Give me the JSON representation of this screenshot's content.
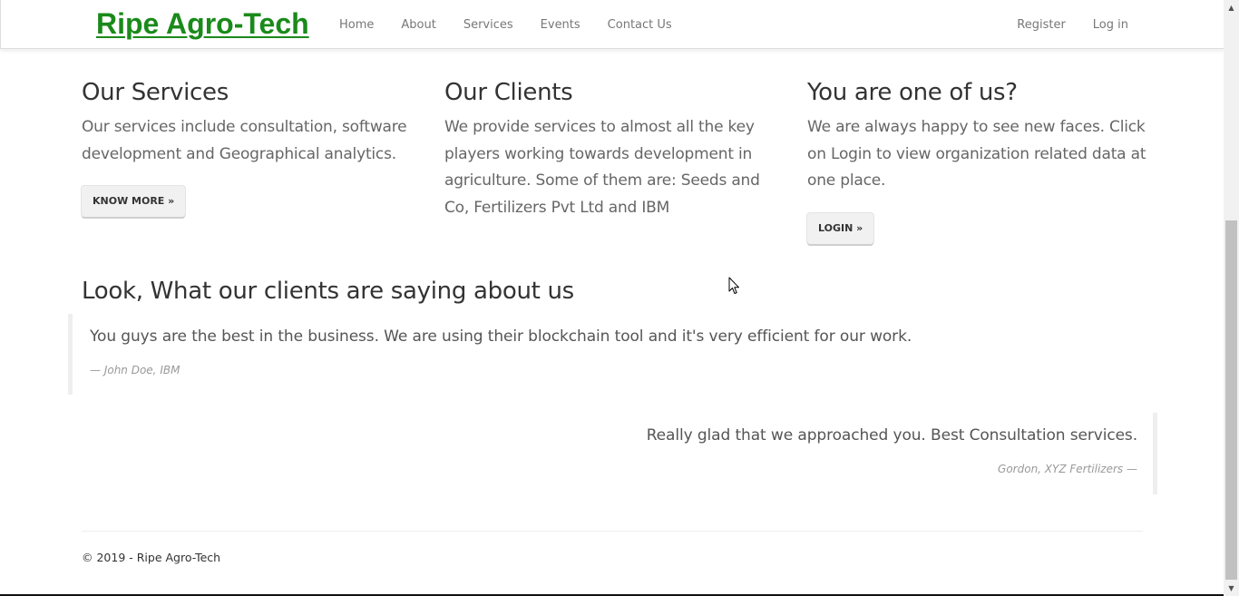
{
  "navbar": {
    "brand": "Ripe Agro-Tech",
    "links": [
      "Home",
      "About",
      "Services",
      "Events",
      "Contact Us"
    ],
    "right_links": [
      "Register",
      "Log in"
    ]
  },
  "columns": [
    {
      "title": "Our Services",
      "text": "Our services include consultation, software development and Geographical analytics.",
      "button": "KNOW MORE »"
    },
    {
      "title": "Our Clients",
      "text": "We provide services to almost all the key players working towards development in agriculture. Some of them are: Seeds and Co, Fertilizers Pvt Ltd and IBM"
    },
    {
      "title": "You are one of us?",
      "text": "We are always happy to see new faces. Click on Login to view organization related data at one place.",
      "button": "LOGIN »"
    }
  ],
  "testimonials": {
    "heading": "Look, What our clients are saying about us",
    "items": [
      {
        "quote": "You guys are the best in the business. We are using their blockchain tool and it's very efficient for our work.",
        "cite": "— John Doe, IBM"
      },
      {
        "quote": "Really glad that we approached you. Best Consultation services.",
        "cite": "Gordon, XYZ Fertilizers —"
      }
    ]
  },
  "footer": {
    "text": "© 2019 - Ripe Agro-Tech"
  },
  "colors": {
    "brand": "#1a8a1a",
    "nav_text": "#777777",
    "body_text": "#666666",
    "heading_text": "#333333"
  },
  "icons": {
    "cursor": "mouse-pointer-icon",
    "scroll_up": "triangle-up-icon",
    "scroll_down": "triangle-down-icon"
  }
}
